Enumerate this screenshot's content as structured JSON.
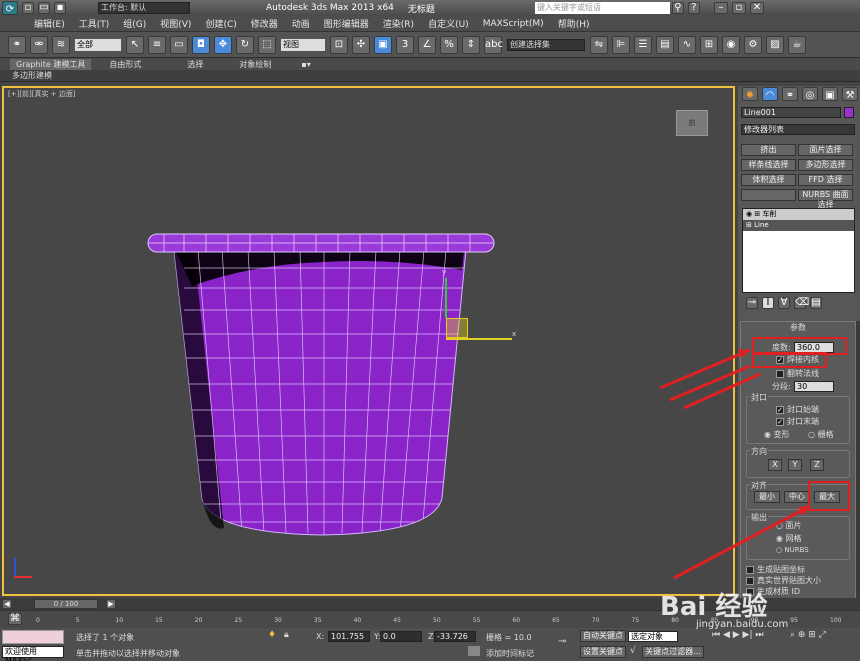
{
  "title": {
    "workspace": "工作台: 默认",
    "app": "Autodesk 3ds Max  2013 x64",
    "file": "无标题",
    "search_placeholder": "键入关键字或短语"
  },
  "menu": [
    "编辑(E)",
    "工具(T)",
    "组(G)",
    "视图(V)",
    "创建(C)",
    "修改器",
    "动画",
    "图形编辑器",
    "渲染(R)",
    "自定义(U)",
    "MAXScript(M)",
    "帮助(H)"
  ],
  "toolbar": {
    "selection_filter": "全部",
    "ref_coord": "视图",
    "named_selection": "创建选择集"
  },
  "ribbon": {
    "tabs": [
      "Graphite 建模工具",
      "自由形式",
      "选择",
      "对象绘制"
    ],
    "sub": "多边形建模"
  },
  "viewport": {
    "label": "[+][前][真实 + 边面]",
    "cube": "前",
    "axis_x": "x",
    "axis_y": "y"
  },
  "panel": {
    "object_name": "Line001",
    "modifier_list": "修改器列表",
    "buttons": [
      "挤出",
      "面片选择",
      "样条线选择",
      "多边形选择",
      "体积选择",
      "FFD 选择",
      "",
      "NURBS 曲面选择"
    ],
    "stack": [
      "车削",
      "Line"
    ],
    "params_title": "参数",
    "degrees_label": "度数:",
    "degrees_value": "360.0",
    "weld_core": "焊接内核",
    "flip_normals": "翻转法线",
    "segments_label": "分段:",
    "segments_value": "30",
    "cap_title": "封口",
    "cap_start": "封口始端",
    "cap_end": "封口末端",
    "morph": "变形",
    "grid": "栅格",
    "direction_title": "方向",
    "dir_x": "X",
    "dir_y": "Y",
    "dir_z": "Z",
    "align_title": "对齐",
    "align_min": "最小",
    "align_center": "中心",
    "align_max": "最大",
    "output_title": "输出",
    "out_patch": "面片",
    "out_mesh": "网格",
    "out_nurbs": "NURBS",
    "gen_map": "生成贴图坐标",
    "real_world": "真实世界贴图大小",
    "gen_mat": "生成材质 ID"
  },
  "timeline": {
    "frame": "0 / 100",
    "ticks": [
      "0",
      "5",
      "10",
      "15",
      "20",
      "25",
      "30",
      "35",
      "40",
      "45",
      "50",
      "55",
      "60",
      "65",
      "70",
      "75",
      "80",
      "85",
      "90",
      "95",
      "100"
    ]
  },
  "status": {
    "welcome": "欢迎使用 MAXSc",
    "selected": "选择了 1 个对象",
    "hint": "单击并拖动以选择并移动对象",
    "x_label": "X:",
    "x": "101.755",
    "y_label": "Y:",
    "y": "0.0",
    "z_label": "Z:",
    "z": "-33.726",
    "grid": "栅格 = 10.0",
    "auto_key": "自动关键点",
    "set_key": "设置关键点",
    "selected_obj": "选定对象",
    "key_filter": "关键点过滤器...",
    "add_time_tag": "添加时间标记"
  },
  "watermark": {
    "brand": "Bai 经验",
    "url": "jingyan.baidu.com"
  },
  "colors": {
    "accent": "#f0c040",
    "object": "#9b30d0",
    "annot": "#e02020"
  }
}
